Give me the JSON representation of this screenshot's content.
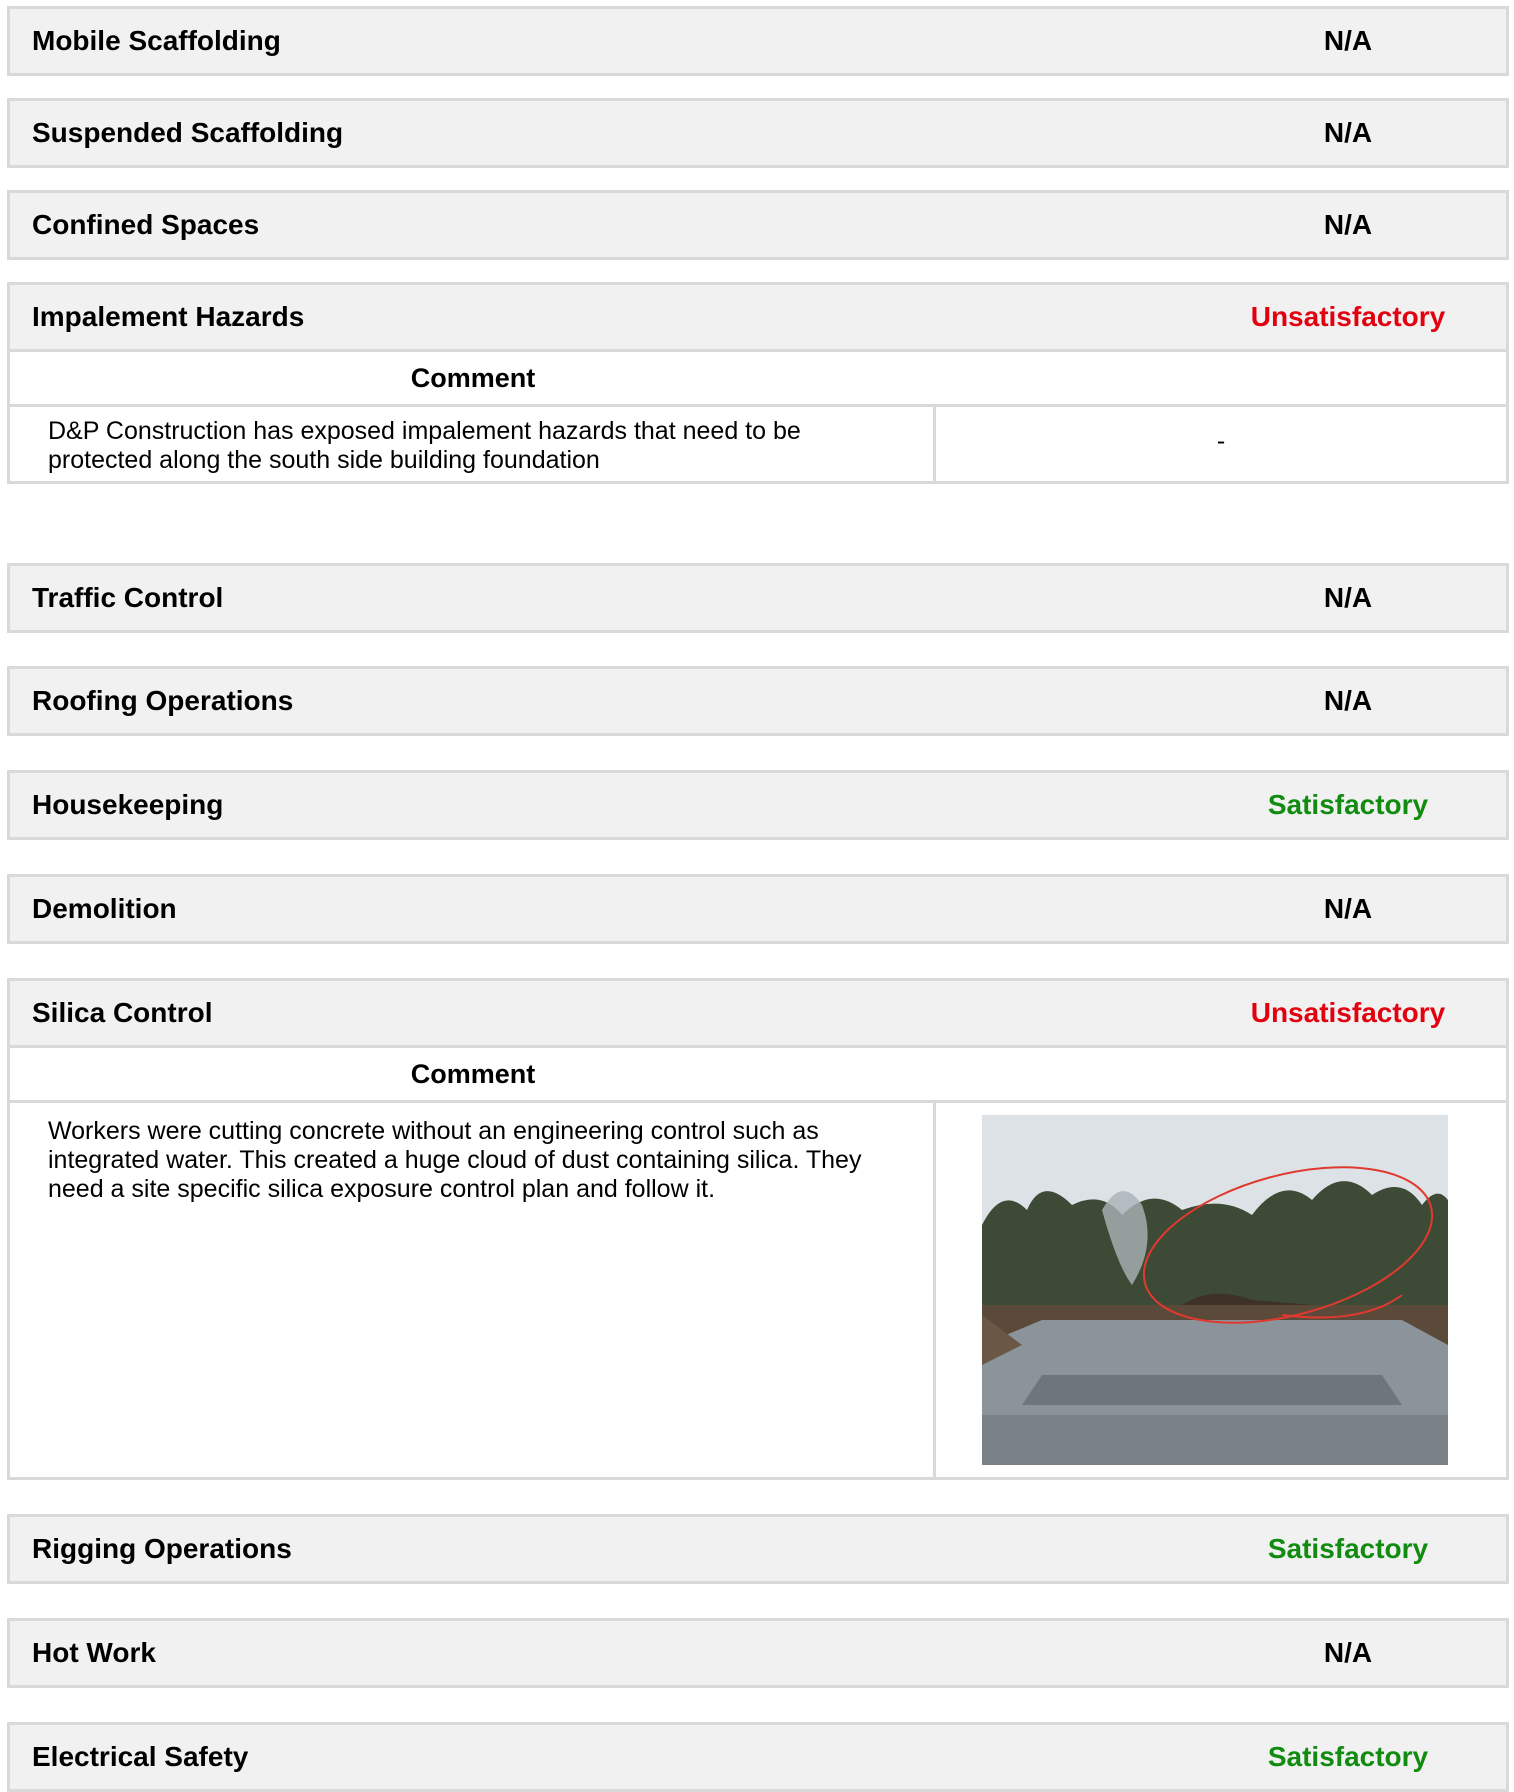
{
  "sections": [
    {
      "title": "Mobile Scaffolding",
      "status": "N/A"
    },
    {
      "title": "Suspended Scaffolding",
      "status": "N/A"
    },
    {
      "title": "Confined Spaces",
      "status": "N/A"
    },
    {
      "title": "Impalement Hazards",
      "status": "Unsatisfactory",
      "comment_label": "Comment",
      "comment": "D&P Construction has exposed impalement hazards that need to be protected along the south side building foundation",
      "side": "-"
    },
    {
      "title": "Traffic Control",
      "status": "N/A"
    },
    {
      "title": "Roofing Operations",
      "status": "N/A"
    },
    {
      "title": "Housekeeping",
      "status": "Satisfactory"
    },
    {
      "title": "Demolition",
      "status": "N/A"
    },
    {
      "title": "Silica Control",
      "status": "Unsatisfactory",
      "comment_label": "Comment",
      "comment": "Workers were cutting concrete without an engineering control such as integrated water. This created a huge cloud of dust containing silica. They need a site specific silica exposure control plan and follow it.",
      "photo_icon": "construction-site-photo"
    },
    {
      "title": "Rigging Operations",
      "status": "Satisfactory"
    },
    {
      "title": "Hot Work",
      "status": "N/A"
    },
    {
      "title": "Electrical Safety",
      "status": "Satisfactory"
    }
  ],
  "colors": {
    "unsatisfactory": "#e3000f",
    "satisfactory": "#118c11",
    "na": "#000000"
  }
}
